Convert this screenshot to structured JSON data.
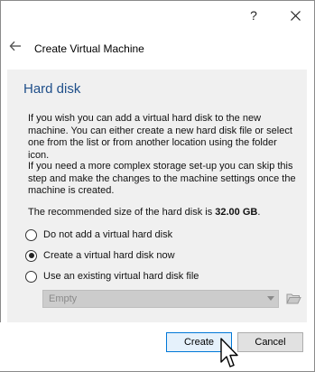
{
  "titlebar": {
    "help_label": "?",
    "help_icon": "question-icon",
    "close_icon": "close-icon"
  },
  "header": {
    "back_icon": "arrow-left-icon",
    "title": "Create Virtual Machine"
  },
  "main": {
    "section_title": "Hard disk",
    "paragraph1": "If you wish you can add a virtual hard disk to the new machine. You can either create a new hard disk file or select one from the list or from another location using the folder icon.",
    "paragraph2": "If you need a more complex storage set-up you can skip this step and make the changes to the machine settings once the machine is created.",
    "recommended_prefix": "The recommended size of the hard disk is ",
    "recommended_size": "32.00 GB",
    "recommended_suffix": ".",
    "options": [
      {
        "label": "Do not add a virtual hard disk",
        "checked": false
      },
      {
        "label": "Create a virtual hard disk now",
        "checked": true
      },
      {
        "label": "Use an existing virtual hard disk file",
        "checked": false
      }
    ],
    "disk_select": {
      "value": "Empty",
      "enabled": false
    },
    "folder_icon": "folder-open-icon"
  },
  "footer": {
    "create_label": "Create",
    "cancel_label": "Cancel"
  },
  "colors": {
    "section_title": "#1f4f8a",
    "panel_bg": "#f0f0f0",
    "default_button_border": "#0078d7"
  }
}
